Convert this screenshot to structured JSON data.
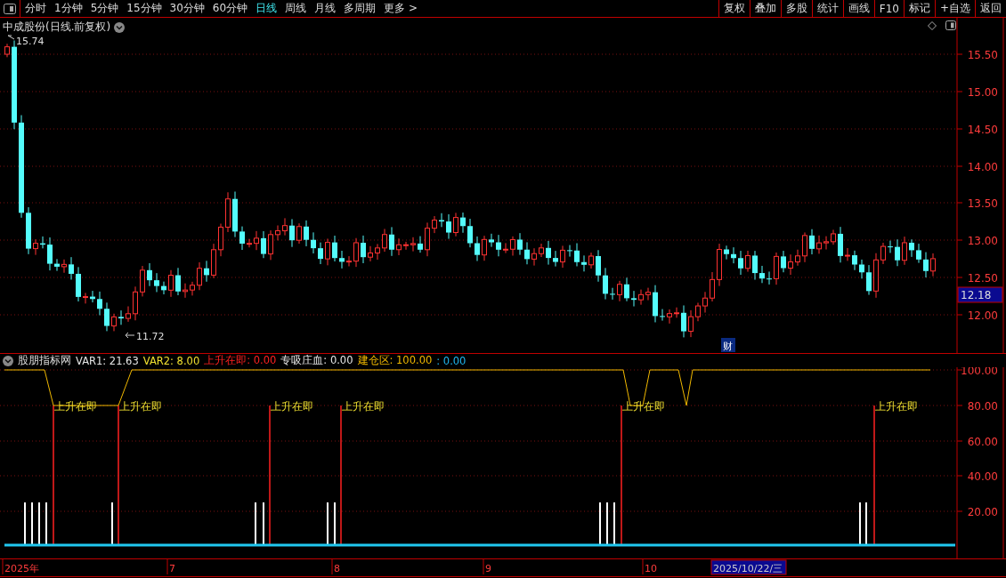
{
  "toolbar": {
    "tabs": [
      {
        "label": "分时",
        "selected": false
      },
      {
        "label": "1分钟",
        "selected": false
      },
      {
        "label": "5分钟",
        "selected": false
      },
      {
        "label": "15分钟",
        "selected": false
      },
      {
        "label": "30分钟",
        "selected": false
      },
      {
        "label": "60分钟",
        "selected": false
      },
      {
        "label": "日线",
        "selected": true
      },
      {
        "label": "周线",
        "selected": false
      },
      {
        "label": "月线",
        "selected": false
      },
      {
        "label": "多周期",
        "selected": false
      },
      {
        "label": "更多 >",
        "selected": false
      }
    ],
    "buttons": [
      "复权",
      "叠加",
      "多股",
      "统计",
      "画线",
      "F10",
      "标记",
      "+自选",
      "返回"
    ]
  },
  "price_chart": {
    "title": "中成股份(日线.前复权)",
    "high_label": "15.74",
    "low_label": "11.72",
    "axis_labels": [
      "15.50",
      "15.00",
      "14.50",
      "14.00",
      "13.50",
      "13.00",
      "12.50",
      "12.00"
    ],
    "current_price": "12.18",
    "event_badge": "财"
  },
  "indicator": {
    "name": "股朋指标网",
    "legend": [
      {
        "text": "VAR1: 21.63",
        "color": "#e6e6e6"
      },
      {
        "text": "VAR2: 8.00",
        "color": "#f0e030"
      },
      {
        "text": "上升在即: 0.00",
        "color": "#ff2020"
      },
      {
        "text": "专吸庄血: 0.00",
        "color": "#e6e6e6"
      },
      {
        "text": "建仓区: 100.00",
        "color": "#f0b800"
      },
      {
        "text": ": 0.00",
        "color": "#20b8f0"
      }
    ],
    "signal_labels": [
      "上升在即",
      "上升在即",
      "上升在即",
      "上升在即",
      "上升在即",
      "上升在即"
    ],
    "axis_labels": [
      "100.00",
      "80.00",
      "60.00",
      "40.00",
      "20.00"
    ]
  },
  "date_axis": {
    "labels": [
      "2025年",
      "7",
      "8",
      "9",
      "10"
    ],
    "cursor_date": "2025/10/22/三"
  }
}
